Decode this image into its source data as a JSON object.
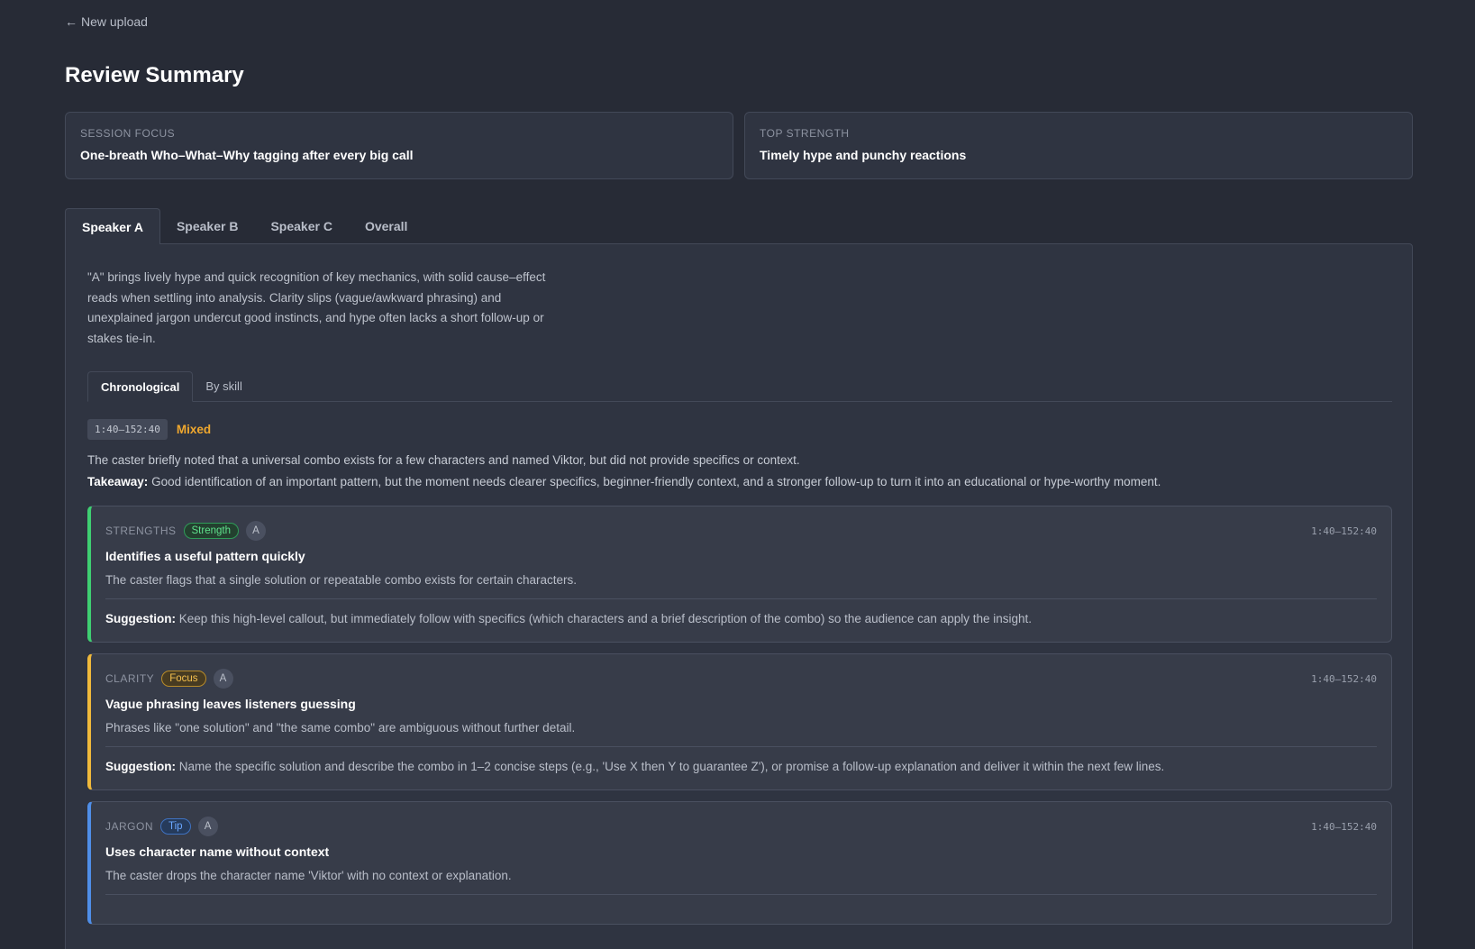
{
  "nav": {
    "back_arrow": "←",
    "back_label": "New upload"
  },
  "page": {
    "title": "Review Summary"
  },
  "summary": {
    "session_focus_label": "SESSION FOCUS",
    "session_focus_value": "One-breath Who–What–Why tagging after every big call",
    "top_strength_label": "TOP STRENGTH",
    "top_strength_value": "Timely hype and punchy reactions"
  },
  "speaker_tabs": [
    "Speaker A",
    "Speaker B",
    "Speaker C",
    "Overall"
  ],
  "active_speaker_tab": "Speaker A",
  "overview": "\"A\" brings lively hype and quick recognition of key mechanics, with solid cause–effect reads when settling into analysis. Clarity slips (vague/awkward phrasing) and unexplained jargon undercut good instincts, and hype often lacks a short follow-up or stakes tie-in.",
  "view_tabs": [
    "Chronological",
    "By skill"
  ],
  "active_view_tab": "Chronological",
  "moment": {
    "timestamp": "1:40–152:40",
    "verdict": "Mixed",
    "description": "The caster briefly noted that a universal combo exists for a few characters and named Viktor, but did not provide specifics or context.",
    "takeaway_label": "Takeaway:",
    "takeaway": "Good identification of an important pattern, but the moment needs clearer specifics, beginner-friendly context, and a stronger follow-up to turn it into an educational or hype-worthy moment."
  },
  "suggestion_label": "Suggestion:",
  "cards": [
    {
      "category": "STRENGTHS",
      "pill": "Strength",
      "speaker": "A",
      "time": "1:40–152:40",
      "title": "Identifies a useful pattern quickly",
      "body": "The caster flags that a single solution or repeatable combo exists for certain characters.",
      "suggestion": "Keep this high-level callout, but immediately follow with specifics (which characters and a brief description of the combo) so the audience can apply the insight.",
      "color": "#3fcf72"
    },
    {
      "category": "CLARITY",
      "pill": "Focus",
      "speaker": "A",
      "time": "1:40–152:40",
      "title": "Vague phrasing leaves listeners guessing",
      "body": "Phrases like \"one solution\" and \"the same combo\" are ambiguous without further detail.",
      "suggestion": "Name the specific solution and describe the combo in 1–2 concise steps (e.g., 'Use X then Y to guarantee Z'), or promise a follow-up explanation and deliver it within the next few lines.",
      "color": "#f0b93b"
    },
    {
      "category": "JARGON",
      "pill": "Tip",
      "speaker": "A",
      "time": "1:40–152:40",
      "title": "Uses character name without context",
      "body": "The caster drops the character name 'Viktor' with no context or explanation.",
      "suggestion": "",
      "color": "#4f8ee8"
    }
  ]
}
